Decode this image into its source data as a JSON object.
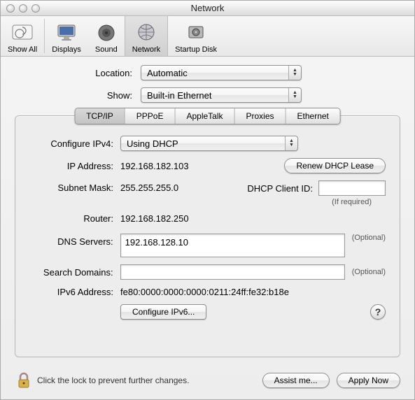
{
  "window": {
    "title": "Network"
  },
  "toolbar": {
    "items": [
      {
        "label": "Show All"
      },
      {
        "label": "Displays"
      },
      {
        "label": "Sound"
      },
      {
        "label": "Network"
      },
      {
        "label": "Startup Disk"
      }
    ]
  },
  "selectors": {
    "location_label": "Location:",
    "location_value": "Automatic",
    "show_label": "Show:",
    "show_value": "Built-in Ethernet"
  },
  "tabs": [
    {
      "label": "TCP/IP"
    },
    {
      "label": "PPPoE"
    },
    {
      "label": "AppleTalk"
    },
    {
      "label": "Proxies"
    },
    {
      "label": "Ethernet"
    }
  ],
  "tcpip": {
    "configure_label": "Configure IPv4:",
    "configure_value": "Using DHCP",
    "ip_label": "IP Address:",
    "ip_value": "192.168.182.103",
    "renew_button": "Renew DHCP Lease",
    "subnet_label": "Subnet Mask:",
    "subnet_value": "255.255.255.0",
    "client_id_label": "DHCP Client ID:",
    "client_id_value": "",
    "client_id_hint": "(If required)",
    "router_label": "Router:",
    "router_value": "192.168.182.250",
    "dns_label": "DNS Servers:",
    "dns_value": "192.168.128.10",
    "optional_text": "(Optional)",
    "search_label": "Search Domains:",
    "search_value": "",
    "ipv6_addr_label": "IPv6 Address:",
    "ipv6_addr_value": "fe80:0000:0000:0000:0211:24ff:fe32:b18e",
    "configure_ipv6_button": "Configure IPv6...",
    "help": "?"
  },
  "footer": {
    "lock_text": "Click the lock to prevent further changes.",
    "assist_button": "Assist me...",
    "apply_button": "Apply Now"
  }
}
